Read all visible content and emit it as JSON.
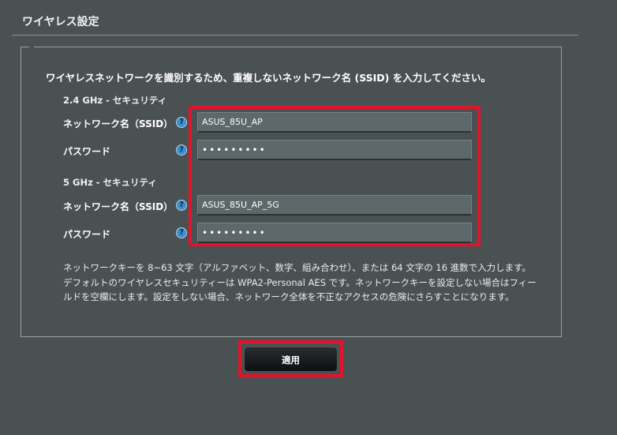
{
  "page": {
    "title": "ワイヤレス設定",
    "intro": "ワイヤレスネットワークを識別するため、重複しないネットワーク名 (SSID) を入力してください。"
  },
  "band_24": {
    "heading": "2.4 GHz - セキュリティ",
    "ssid_label": "ネットワーク名（SSID）",
    "ssid_value": "ASUS_85U_AP",
    "password_label": "パスワード",
    "password_value": "•••••••••"
  },
  "band_5": {
    "heading": "5 GHz - セキュリティ",
    "ssid_label": "ネットワーク名（SSID）",
    "ssid_value": "ASUS_85U_AP_5G",
    "password_label": "パスワード",
    "password_value": "•••••••••"
  },
  "help_glyph": "?",
  "note": "ネットワークキーを 8~63 文字（アルファベット、数字、組み合わせ）、または 64 文字の 16 進数で入力します。デフォルトのワイヤレスセキュリティーは WPA2-Personal AES です。ネットワークキーを設定しない場合はフィールドを空欄にします。設定をしない場合、ネットワーク全体を不正なアクセスの危険にさらすことになります。",
  "apply_label": "適用",
  "colors": {
    "background": "#4a5153",
    "highlight": "#e3132a",
    "help_icon": "#3d8ec9"
  }
}
